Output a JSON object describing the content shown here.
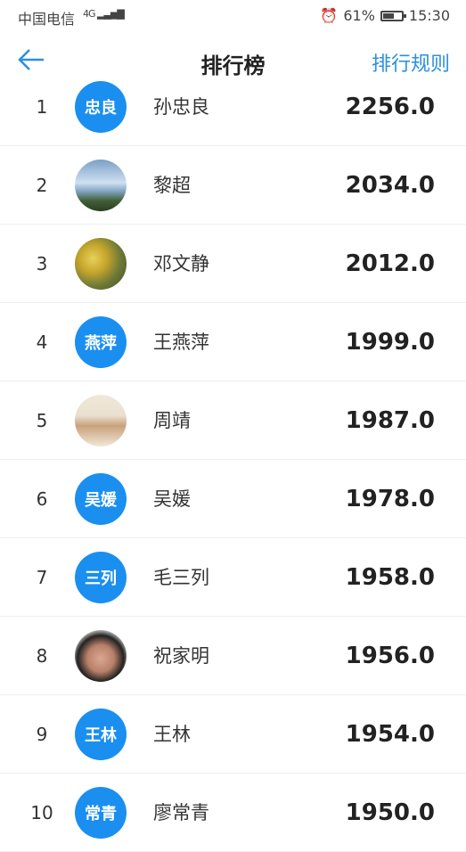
{
  "status": {
    "carrier": "中国电信",
    "network": "4G",
    "battery_text": "61%",
    "battery_level": 0.61,
    "time": "15:30"
  },
  "nav": {
    "back_icon": "arrow-left-icon",
    "title": "排行榜",
    "rules": "排行规则",
    "accent": "#2c8fe0"
  },
  "rankings": [
    {
      "rank": "1",
      "avatar_text": "忠良",
      "name": "孙忠良",
      "score": "2256.0"
    },
    {
      "rank": "2",
      "avatar_text": "",
      "name": "黎超",
      "score": "2034.0"
    },
    {
      "rank": "3",
      "avatar_text": "",
      "name": "邓文静",
      "score": "2012.0"
    },
    {
      "rank": "4",
      "avatar_text": "燕萍",
      "name": "王燕萍",
      "score": "1999.0"
    },
    {
      "rank": "5",
      "avatar_text": "",
      "name": "周靖",
      "score": "1987.0"
    },
    {
      "rank": "6",
      "avatar_text": "吴媛",
      "name": "吴媛",
      "score": "1978.0"
    },
    {
      "rank": "7",
      "avatar_text": "三列",
      "name": "毛三列",
      "score": "1958.0"
    },
    {
      "rank": "8",
      "avatar_text": "",
      "name": "祝家明",
      "score": "1956.0"
    },
    {
      "rank": "9",
      "avatar_text": "王林",
      "name": "王林",
      "score": "1954.0"
    },
    {
      "rank": "10",
      "avatar_text": "常青",
      "name": "廖常青",
      "score": "1950.0"
    }
  ]
}
